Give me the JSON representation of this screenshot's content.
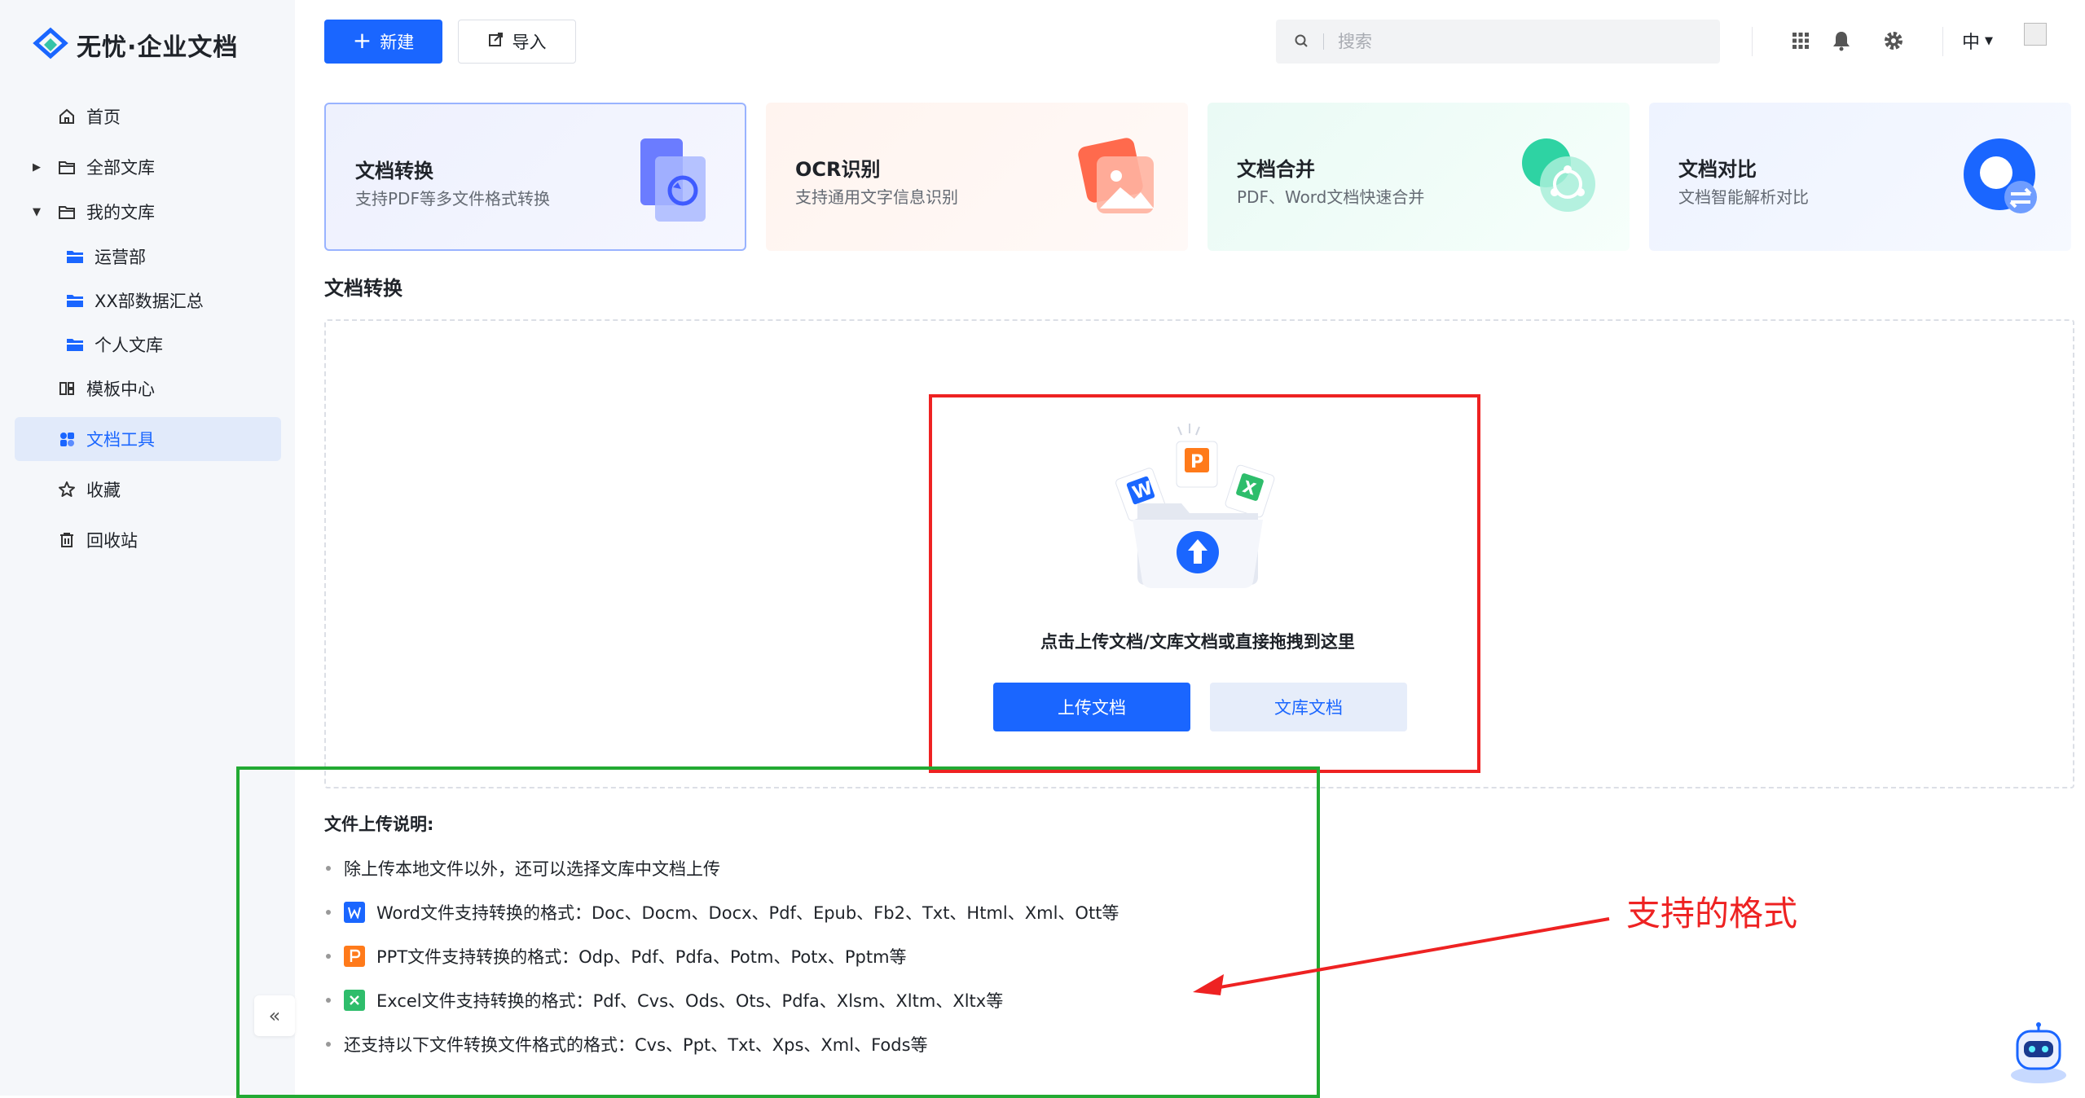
{
  "app": {
    "logo_text": "无忧·企业文档"
  },
  "sidebar": {
    "items": [
      {
        "label": "首页",
        "icon": "home-icon"
      },
      {
        "label": "全部文库",
        "icon": "folder-icon",
        "expanded": false
      },
      {
        "label": "我的文库",
        "icon": "folder-icon",
        "expanded": true
      },
      {
        "label": "运营部",
        "icon": "folder-filled-icon"
      },
      {
        "label": "XX部数据汇总",
        "icon": "folder-filled-icon"
      },
      {
        "label": "个人文库",
        "icon": "folder-filled-icon"
      },
      {
        "label": "模板中心",
        "icon": "template-icon"
      },
      {
        "label": "文档工具",
        "icon": "tools-icon",
        "active": true
      },
      {
        "label": "收藏",
        "icon": "star-icon"
      },
      {
        "label": "回收站",
        "icon": "trash-icon"
      }
    ],
    "collapse_label": "«"
  },
  "topbar": {
    "new_label": "新建",
    "import_label": "导入",
    "search_placeholder": "搜索",
    "lang_label": "中"
  },
  "tools": [
    {
      "title": "文档转换",
      "desc": "支持PDF等多文件格式转换"
    },
    {
      "title": "OCR识别",
      "desc": "支持通用文字信息识别"
    },
    {
      "title": "文档合并",
      "desc": "PDF、Word文档快速合并"
    },
    {
      "title": "文档对比",
      "desc": "文档智能解析对比"
    }
  ],
  "section_title": "文档转换",
  "upload": {
    "hint": "点击上传文档/文库文档或直接拖拽到这里",
    "upload_btn": "上传文档",
    "library_btn": "文库文档"
  },
  "instructions": {
    "title": "文件上传说明:",
    "items": [
      "除上传本地文件以外，还可以选择文库中文档上传",
      "Word文件支持转换的格式：Doc、Docm、Docx、Pdf、Epub、Fb2、Txt、Html、Xml、Ott等",
      "PPT文件支持转换的格式：Odp、Pdf、Pdfa、Potm、Potx、Pptm等",
      "Excel文件支持转换的格式：Pdf、Cvs、Ods、Ots、Pdfa、Xlsm、Xltm、Xltx等",
      "还支持以下文件转换文件格式的格式：Cvs、Ppt、Txt、Xps、Xml、Fods等"
    ]
  },
  "annotation": {
    "text": "支持的格式"
  },
  "colors": {
    "primary": "#1a66ff",
    "annotation_red": "#ee2222",
    "annotation_green": "#22aa33"
  }
}
